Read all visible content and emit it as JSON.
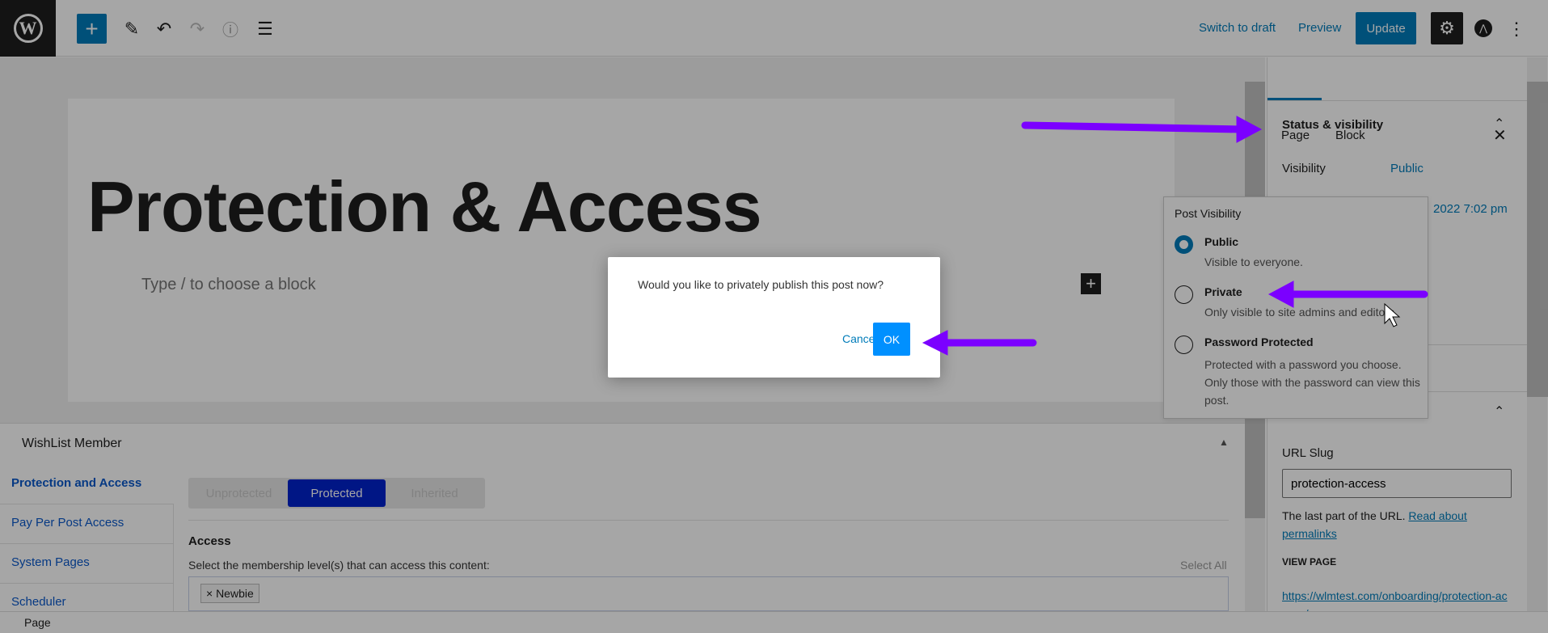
{
  "topbar": {
    "logo": "W",
    "add_icon": "plus-icon",
    "switch_to_draft": "Switch to draft",
    "preview": "Preview",
    "update": "Update"
  },
  "editor": {
    "title": "Protection & Access",
    "placeholder": "Type / to choose a block"
  },
  "wishlist": {
    "heading": "WishList Member",
    "nav": [
      "Protection and Access",
      "Pay Per Post Access",
      "System Pages",
      "Scheduler"
    ],
    "segments": [
      "Unprotected",
      "Protected",
      "Inherited"
    ],
    "selected_segment": "Protected",
    "access_heading": "Access",
    "access_desc": "Select the membership level(s) that can access this content:",
    "select_all": "Select All",
    "tags": [
      "× Newbie"
    ]
  },
  "sidebar": {
    "tabs": [
      "Page",
      "Block"
    ],
    "active_tab": "Page",
    "status_heading": "Status & visibility",
    "visibility_label": "Visibility",
    "visibility_value": "Public",
    "publish_value": "2022 7:02 pm",
    "url_slug_label": "URL Slug",
    "url_slug_value": "protection-access",
    "url_help": "The last part of the URL.",
    "url_help_link": "Read about permalinks",
    "view_page": "VIEW PAGE",
    "page_url": "https://wlmtest.com/onboarding/protection-access/"
  },
  "popover": {
    "title": "Post Visibility",
    "options": [
      {
        "label": "Public",
        "desc": "Visible to everyone.",
        "selected": true
      },
      {
        "label": "Private",
        "desc": "Only visible to site admins and editors.",
        "selected": false
      },
      {
        "label": "Password Protected",
        "desc": "Protected with a password you choose. Only those with the password can view this post.",
        "selected": false
      }
    ]
  },
  "dialog": {
    "message": "Would you like to privately publish this post now?",
    "cancel": "Cancel",
    "ok": "OK"
  },
  "statusbar": {
    "breadcrumb": "Page"
  },
  "colors": {
    "accent": "#007cba",
    "annotation_arrow": "#7b00ff",
    "protected": "#0022cc"
  }
}
